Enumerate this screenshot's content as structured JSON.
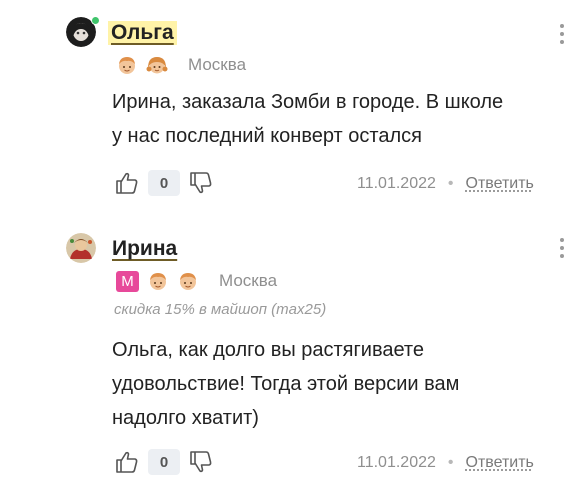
{
  "comments": [
    {
      "author": "Ольга",
      "city": "Москва",
      "text_lines": [
        "Ирина, заказала Зомби в городе. В школе",
        "у нас последний конверт остался"
      ],
      "likes": "0",
      "date": "11.01.2022",
      "reply_label": "Ответить",
      "separator": "•"
    },
    {
      "author": "Ирина",
      "badge": "M",
      "city": "Москва",
      "promo": "скидка 15% в майшоп (max25)",
      "text_lines": [
        "Ольга, как долго вы растягиваете",
        "удовольствие! Тогда этой версии вам",
        "надолго хватит)"
      ],
      "likes": "0",
      "date": "11.01.2022",
      "reply_label": "Ответить",
      "separator": "•"
    }
  ],
  "colors": {
    "highlight": "#fff3a8",
    "online": "#3fc46b",
    "badge_m": "#e7499a"
  }
}
